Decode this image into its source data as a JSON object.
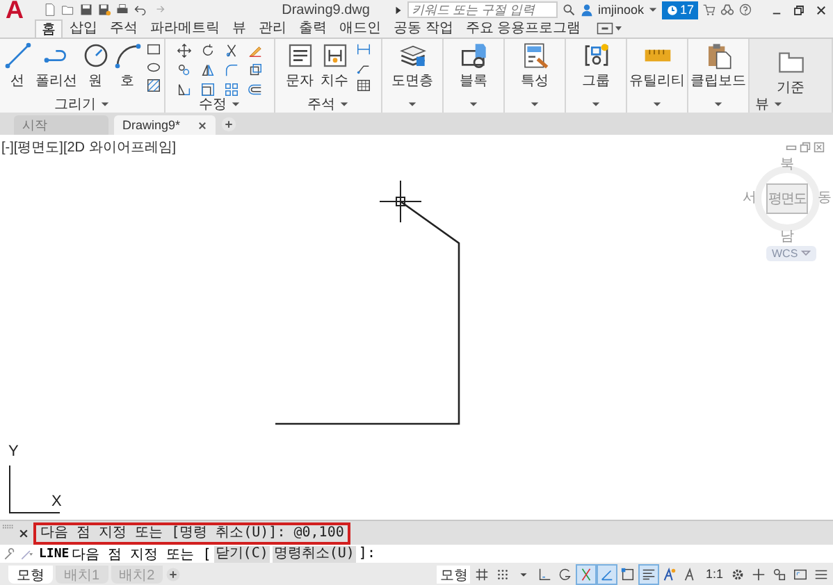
{
  "app": {
    "logo": "A",
    "title": "Drawing9.dwg"
  },
  "search": {
    "placeholder": "키워드 또는 구절 입력"
  },
  "user": {
    "name": "imjinook"
  },
  "notifications": {
    "count": "17"
  },
  "ribbon_tabs": [
    {
      "label": "홈",
      "selected": true
    },
    {
      "label": "삽입",
      "selected": false
    },
    {
      "label": "주석",
      "selected": false
    },
    {
      "label": "파라메트릭",
      "selected": false
    },
    {
      "label": "뷰",
      "selected": false
    },
    {
      "label": "관리",
      "selected": false
    },
    {
      "label": "출력",
      "selected": false
    },
    {
      "label": "애드인",
      "selected": false
    },
    {
      "label": "공동 작업",
      "selected": false
    },
    {
      "label": "주요 응용프로그램",
      "selected": false
    }
  ],
  "panels": [
    {
      "kind": "draw",
      "title": "그리기",
      "tools": [
        "선",
        "폴리선",
        "원",
        "호"
      ]
    },
    {
      "kind": "modify",
      "title": "수정"
    },
    {
      "kind": "annotate",
      "title": "주석",
      "tools": [
        "문자",
        "치수"
      ]
    },
    {
      "kind": "single",
      "tools": [
        "도면층"
      ]
    },
    {
      "kind": "single",
      "tools": [
        "블록"
      ]
    },
    {
      "kind": "single",
      "tools": [
        "특성"
      ]
    },
    {
      "kind": "single",
      "tools": [
        "그룹"
      ]
    },
    {
      "kind": "single",
      "tools": [
        "유틸리티"
      ]
    },
    {
      "kind": "single",
      "tools": [
        "클립보드"
      ]
    },
    {
      "kind": "view",
      "title": "뷰",
      "tools": [
        "기준"
      ]
    }
  ],
  "file_tabs": [
    {
      "label": "시작",
      "selected": false,
      "closable": false
    },
    {
      "label": "Drawing9*",
      "selected": true,
      "closable": true
    }
  ],
  "viewport": {
    "label": "[-][평면도][2D 와이어프레임]"
  },
  "viewcube": {
    "north": "북",
    "west": "서",
    "east": "동",
    "south": "남",
    "face": "평면도",
    "coordinate_system": "WCS"
  },
  "ucs": {
    "x": "X",
    "y": "Y"
  },
  "command_history": "다음 점 지정 또는 [명령 취소(U)]: @0,100",
  "command_line": {
    "command": "LINE",
    "prompt": "다음 점 지정 또는 [",
    "options": [
      "닫기(C)",
      "명령취소(U)"
    ],
    "suffix": "]:"
  },
  "layout_tabs": [
    {
      "label": "모형",
      "selected": true
    },
    {
      "label": "배치1",
      "selected": false
    },
    {
      "label": "배치2",
      "selected": false
    }
  ],
  "status_bar": {
    "space": "모형",
    "scale": "1:1",
    "toggles": [
      {
        "on": false
      },
      {
        "on": false
      },
      {
        "on": false
      },
      {
        "on": false
      },
      {
        "on": false
      },
      {
        "on": true
      },
      {
        "on": true
      },
      {
        "on": false
      },
      {
        "on": true
      },
      {
        "on": false
      },
      {
        "on": false
      }
    ],
    "tools_after": [
      {
        "on": false
      },
      {
        "on": false
      },
      {
        "on": false
      },
      {
        "on": false
      },
      {
        "on": false
      }
    ]
  }
}
